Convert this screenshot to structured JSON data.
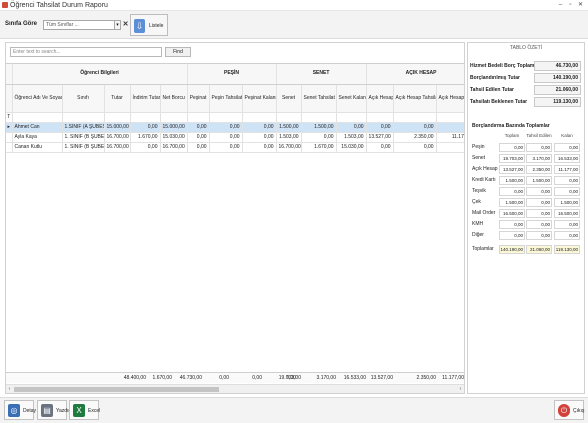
{
  "window": {
    "title": "Öğrenci Tahsilat Durum Raporu",
    "min": "–",
    "restore": "▫",
    "close": "✕"
  },
  "filter": {
    "label": "Sınıfa Göre",
    "combo_value": "Tüm Sınıflar ...",
    "clear": "✕",
    "drop": "▾",
    "listele": "Listele"
  },
  "search": {
    "placeholder": "Enter text to search...",
    "find": "Find"
  },
  "grid": {
    "bands": [
      "Öğrenci Bilgileri",
      "PEŞİN",
      "SENET",
      "AÇIK HESAP"
    ],
    "columns": [
      "Öğrenci Adı Ve Soyadı",
      "Sınıfı",
      "Tutar",
      "İndirim Tutar",
      "Net Borcu",
      "Peşinat",
      "Peşin Tahsilat",
      "Peşinat Kalanı",
      "Senet",
      "Senet Tahsilat",
      "Senet Kalanı",
      "Açık Hesap",
      "Açık Hesap Tahsilat",
      "Açık Hesap Kalan"
    ],
    "rows": [
      [
        "Ahmet Can",
        "1.SINIF (A ŞUBESİ)",
        "15.000,00",
        "0,00",
        "15.000,00",
        "0,00",
        "0,00",
        "0,00",
        "1.500,00",
        "1.500,00",
        "0,00",
        "0,00",
        "0,00",
        "0,00"
      ],
      [
        "Ayla Kaya",
        "1. SINIF (B ŞUBESİ)",
        "16.700,00",
        "1.670,00",
        "15.030,00",
        "0,00",
        "0,00",
        "0,00",
        "1.503,00",
        "0,00",
        "1.503,00",
        "13.527,00",
        "2.350,00",
        "11.177,00"
      ],
      [
        "Canan Kutlu",
        "1. SINIF (B ŞUBESİ)",
        "16.700,00",
        "0,00",
        "16.700,00",
        "0,00",
        "0,00",
        "0,00",
        "16.700,00",
        "1.670,00",
        "15.030,00",
        "0,00",
        "0,00",
        "0,00"
      ]
    ],
    "filter_marker": "T",
    "row_indicator": "▸",
    "totals": [
      "48.400,00",
      "1.670,00",
      "46.730,00",
      "0,00",
      "0,00",
      "0,00",
      "19.703,00",
      "3.170,00",
      "16.533,00",
      "13.527,00",
      "2.350,00",
      "11.177,00"
    ],
    "scroll_left": "‹",
    "scroll_right": "›"
  },
  "summary": {
    "title": "TABLO ÖZETİ",
    "rows": [
      {
        "label": "Hizmet Bedeli Borç Toplamı",
        "value": "46.730,00"
      },
      {
        "label": "Borçlandırılmış Tutar",
        "value": "140.190,00"
      },
      {
        "label": "Tahsil Edilen Tutar",
        "value": "21.060,00"
      },
      {
        "label": "Tahsilatı Beklenen Tutar",
        "value": "119.130,00"
      }
    ]
  },
  "breakdown": {
    "title": "Borçlandırma Bazında Toplamlar",
    "headers": [
      "Toplam",
      "Tahsil Edilen",
      "Kalan"
    ],
    "rows": [
      {
        "label": "Peşin",
        "values": [
          "0,00",
          "0,00",
          "0,00"
        ]
      },
      {
        "label": "Senet",
        "values": [
          "19.703,00",
          "3.170,00",
          "16.533,00"
        ]
      },
      {
        "label": "Açık Hesap",
        "values": [
          "13.527,00",
          "2.350,00",
          "11.177,00"
        ]
      },
      {
        "label": "Kredi Kartı",
        "values": [
          "1.500,00",
          "1.500,00",
          "0,00"
        ]
      },
      {
        "label": "Teşvik",
        "values": [
          "0,00",
          "0,00",
          "0,00"
        ]
      },
      {
        "label": "Çek",
        "values": [
          "1.500,00",
          "0,00",
          "1.500,00"
        ]
      },
      {
        "label": "Mail Order",
        "values": [
          "16.500,00",
          "0,00",
          "16.500,00"
        ]
      },
      {
        "label": "KMH",
        "values": [
          "0,00",
          "0,00",
          "0,00"
        ]
      },
      {
        "label": "Diğer",
        "values": [
          "0,00",
          "0,00",
          "0,00"
        ]
      },
      {
        "label": "Toplamlar",
        "values": [
          "140.190,00",
          "21.060,00",
          "119.130,00"
        ]
      }
    ]
  },
  "bottom": {
    "detay": "Detay",
    "yazdir": "Yazdır",
    "excel": "Excel",
    "cikis": "Çıkış"
  },
  "colors": {
    "selected_row": "#cfe3f7",
    "totals_fill": "#fbf8d8",
    "accent": "#5b8fd6",
    "excel": "#1f7a3f",
    "exit": "#d2413a"
  }
}
